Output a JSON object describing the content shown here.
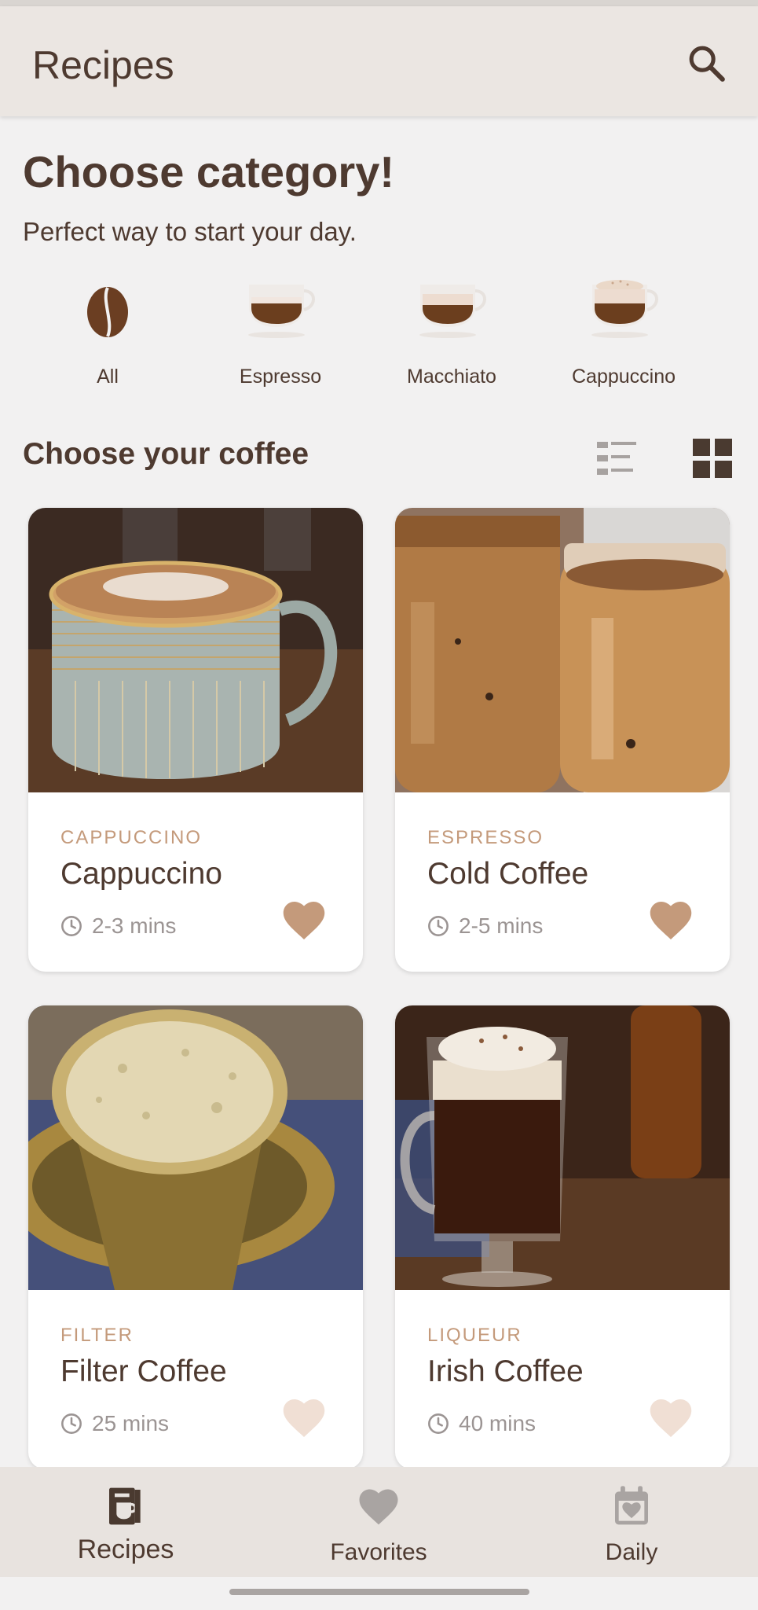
{
  "app_bar": {
    "title": "Recipes"
  },
  "intro": {
    "heading": "Choose category!",
    "subheading": "Perfect way to start your day."
  },
  "categories": [
    {
      "label": "All",
      "icon": "coffee-bean-icon"
    },
    {
      "label": "Espresso",
      "icon": "espresso-cup-icon"
    },
    {
      "label": "Macchiato",
      "icon": "macchiato-cup-icon"
    },
    {
      "label": "Cappuccino",
      "icon": "cappuccino-cup-icon"
    }
  ],
  "coffee_section": {
    "heading": "Choose your coffee",
    "view_mode": "grid"
  },
  "coffees": [
    {
      "category": "CAPPUCCINO",
      "name": "Cappuccino",
      "time": "2-3 mins",
      "favorite": true
    },
    {
      "category": "ESPRESSO",
      "name": "Cold Coffee",
      "time": "2-5 mins",
      "favorite": true
    },
    {
      "category": "FILTER",
      "name": "Filter Coffee",
      "time": "25 mins",
      "favorite": false
    },
    {
      "category": "LIQUEUR",
      "name": "Irish Coffee",
      "time": "40 mins",
      "favorite": false
    }
  ],
  "bottom_nav": [
    {
      "label": "Recipes",
      "icon": "recipe-book-icon",
      "active": true
    },
    {
      "label": "Favorites",
      "icon": "heart-icon",
      "active": false
    },
    {
      "label": "Daily",
      "icon": "calendar-heart-icon",
      "active": false
    }
  ],
  "colors": {
    "app_bar_bg": "#ebe6e2",
    "page_bg": "#f2f1f1",
    "primary_text": "#4e3a30",
    "category_accent": "#c49a7b",
    "favorite_on": "#c49a7b",
    "favorite_off": "#f0dfd4",
    "muted_text": "#9b9493"
  }
}
